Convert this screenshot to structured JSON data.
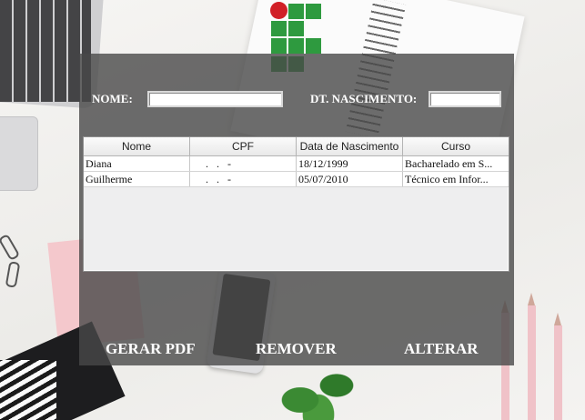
{
  "form": {
    "name_label": "NOME:",
    "name_value": "",
    "birth_label": "DT. NASCIMENTO:",
    "birth_value": ""
  },
  "table": {
    "columns": [
      "Nome",
      "CPF",
      "Data de Nascimento",
      "Curso"
    ],
    "rows": [
      [
        "Diana",
        " .   .   -",
        "18/12/1999",
        "Bacharelado em S..."
      ],
      [
        "Guilherme",
        " .   .   -",
        "05/07/2010",
        "Técnico em Infor..."
      ]
    ]
  },
  "actions": {
    "pdf_label": "GERAR PDF",
    "remove_label": "REMOVER",
    "edit_label": "ALTERAR"
  },
  "colors": {
    "logo_green": "#2e9a3f",
    "logo_red": "#d12027",
    "panel": "#484848"
  },
  "icons": {
    "logo": "ifsp-logo-grid-icon"
  }
}
